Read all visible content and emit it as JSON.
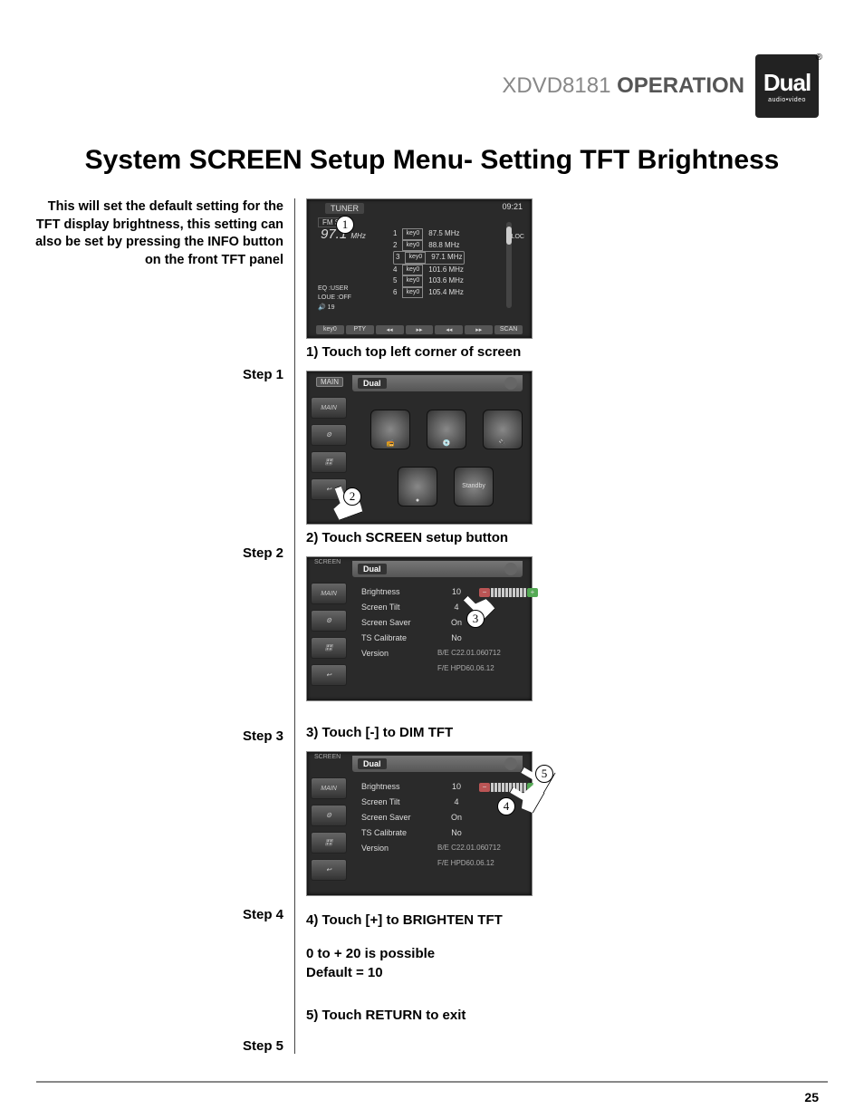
{
  "header": {
    "model": "XDVD8181",
    "section": "OPERATION",
    "brand": "Dual",
    "brand_sub": "audio•video",
    "reg": "®"
  },
  "title": "System SCREEN Setup Menu- Setting TFT Brightness",
  "intro": "This will set the default setting for the TFT display brightness, this setting can also be set by pressing the INFO button on the front TFT panel",
  "steps": {
    "s1": {
      "label": "Step 1",
      "caption": "1) Touch top left corner of screen"
    },
    "s2": {
      "label": "Step 2",
      "caption": "2) Touch SCREEN setup button"
    },
    "s3": {
      "label": "Step 3",
      "caption": "3) Touch [-] to DIM TFT"
    },
    "s4": {
      "label": "Step 4",
      "caption": "4) Touch [+] to BRIGHTEN TFT",
      "range": "0 to + 20 is possible",
      "default": "Default = 10"
    },
    "s5": {
      "label": "Step 5",
      "caption": "5) Touch RETURN to exit"
    }
  },
  "callouts": {
    "c1": "1",
    "c2": "2",
    "c3": "3",
    "c4": "4",
    "c5": "5"
  },
  "shot1": {
    "tab": "TUNER",
    "time": "09:21",
    "band": "FM  ST",
    "freq": "97.1",
    "freq_unit": "MHz",
    "loc": "LOC",
    "presets": [
      {
        "n": "1",
        "tag": "key0",
        "f": "87.5 MHz"
      },
      {
        "n": "2",
        "tag": "key0",
        "f": "88.8 MHz"
      },
      {
        "n": "3",
        "tag": "key0",
        "f": "97.1 MHz"
      },
      {
        "n": "4",
        "tag": "key0",
        "f": "101.6 MHz"
      },
      {
        "n": "5",
        "tag": "key0",
        "f": "103.6 MHz"
      },
      {
        "n": "6",
        "tag": "key0",
        "f": "105.4 MHz"
      }
    ],
    "eq1": "EQ    :USER",
    "eq2": "LOUE :OFF",
    "vol": "19",
    "buttons": [
      "key0",
      "PTY",
      "◂◂",
      "▸▸",
      "◂◂",
      "▸▸",
      "SCAN"
    ]
  },
  "shot2": {
    "top_tab": "MAIN",
    "brand": "Dual",
    "side": [
      "MAIN",
      "⚙",
      "🎛",
      "↩"
    ],
    "sources_row1": [
      "📻",
      "💿",
      "🔌"
    ],
    "sources_row2": [
      "●",
      "Standby"
    ]
  },
  "screen_menu": {
    "tab": "SCREEN",
    "brand": "Dual",
    "side": [
      "MAIN",
      "⚙",
      "🎛",
      "↩"
    ],
    "rows": {
      "brightness": {
        "k": "Brightness",
        "v": "10"
      },
      "tilt": {
        "k": "Screen Tilt",
        "v": "4"
      },
      "saver": {
        "k": "Screen Saver",
        "v": "On"
      },
      "ts": {
        "k": "TS Calibrate",
        "v": "No"
      },
      "ver": {
        "k": "Version",
        "be": "B/E  C22.01.060712",
        "fe": "F/E  HPD60.06.12"
      }
    },
    "minus": "−",
    "plus": "+"
  },
  "page_number": "25"
}
